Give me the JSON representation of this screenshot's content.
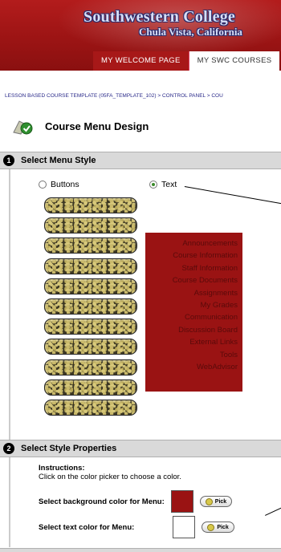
{
  "header": {
    "college_name": "Southwestern College",
    "college_city": "Chula Vista, California",
    "tabs": [
      {
        "label": "MY WELCOME PAGE",
        "active": false
      },
      {
        "label": "MY SWC COURSES",
        "active": true
      }
    ]
  },
  "breadcrumb": "LESSON BASED COURSE TEMPLATE (05FA_TEMPLATE_102) > CONTROL PANEL > COU",
  "page_title": "Course Menu Design",
  "step1": {
    "number": "1",
    "label": "Select Menu Style",
    "options": [
      {
        "label": "Buttons",
        "selected": false
      },
      {
        "label": "Text",
        "selected": true
      }
    ]
  },
  "text_menu": {
    "background_color": "#9a1313",
    "items": [
      "Announcements",
      "Course Information",
      "Staff Information",
      "Course Documents",
      "Assignments",
      "My Grades",
      "Communication",
      "Discussion Board",
      "External Links",
      "Tools",
      "WebAdvisor"
    ]
  },
  "step2": {
    "number": "2",
    "label": "Select Style Properties",
    "instructions_heading": "Instructions:",
    "instructions_text": "Click on the color picker to choose a color.",
    "bg_color_label": "Select background color for Menu:",
    "bg_color_value": "#9a1313",
    "text_color_label": "Select text color for Menu:",
    "text_color_value": "#ffffff",
    "pick_label": "Pick"
  },
  "colors": {
    "brand_red": "#a71818",
    "step_bar": "#d9d9d9"
  }
}
